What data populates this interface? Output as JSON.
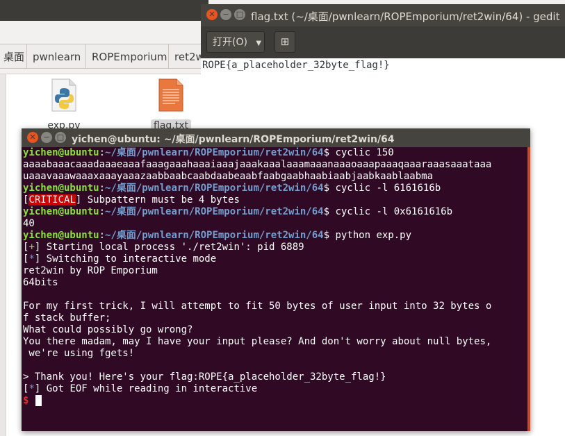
{
  "file_manager": {
    "breadcrumbs": [
      "桌面",
      "pwnlearn",
      "ROPEmporium",
      "ret2w"
    ],
    "files": [
      {
        "name": "exp.py",
        "icon": "python-file-icon"
      },
      {
        "name": "flag.txt",
        "icon": "text-file-icon",
        "selected": true
      }
    ]
  },
  "gedit": {
    "title": "flag.txt (~/桌面/pwnlearn/ROPEmporium/ret2win/64) - gedit",
    "open_label": "打开(O)",
    "new_tab_icon": "new-document-icon",
    "content": "ROPE{a_placeholder_32byte_flag!}"
  },
  "terminal": {
    "title": "yichen@ubuntu: ~/桌面/pwnlearn/ROPEmporium/ret2win/64",
    "user": "yichen@ubuntu",
    "path": "~/桌面/pwnlearn/ROPEmporium/ret2win/64",
    "cmd1": "cyclic 150",
    "pattern1": "aaaabaaacaaadaaaeaaafaaagaaahaaaiaaajaaakaaalaaamaaanaaaoaaapaaaqaaaraaasaaataaa",
    "pattern2": "uaaavaaawaaaxaaayaaazaabbaabcaabdaabeaabfaabgaabhaabiaabjaabkaablaabma",
    "cmd2": "cyclic -l 6161616b",
    "critical_tag": "CRITICAL",
    "critical_msg": "] Subpattern must be 4 bytes",
    "cmd3": "cyclic -l 0x6161616b",
    "result": "40",
    "cmd4": "python exp.py",
    "plus": "+",
    "star": "*",
    "start_msg": "] Starting local process './ret2win': pid 6889",
    "switch_msg": "] Switching to interactive mode",
    "out1": "ret2win by ROP Emporium",
    "out2": "64bits",
    "out3": "For my first trick, I will attempt to fit 50 bytes of user input into 32 bytes o",
    "out4": "f stack buffer;",
    "out5": "What could possibly go wrong?",
    "out6": "You there madam, may I have your input please? And don't worry about null bytes,",
    "out7": " we're using fgets!",
    "out8": "> Thank you! Here's your flag:ROPE{a_placeholder_32byte_flag!}",
    "eof_msg": "] Got EOF while reading in interactive",
    "prompt": "$"
  },
  "colors": {
    "terminal_bg": "#300a24",
    "user_green": "#8ae234",
    "path_blue": "#729fcf",
    "critical_red": "#cc0000",
    "close_orange": "#e95420"
  }
}
